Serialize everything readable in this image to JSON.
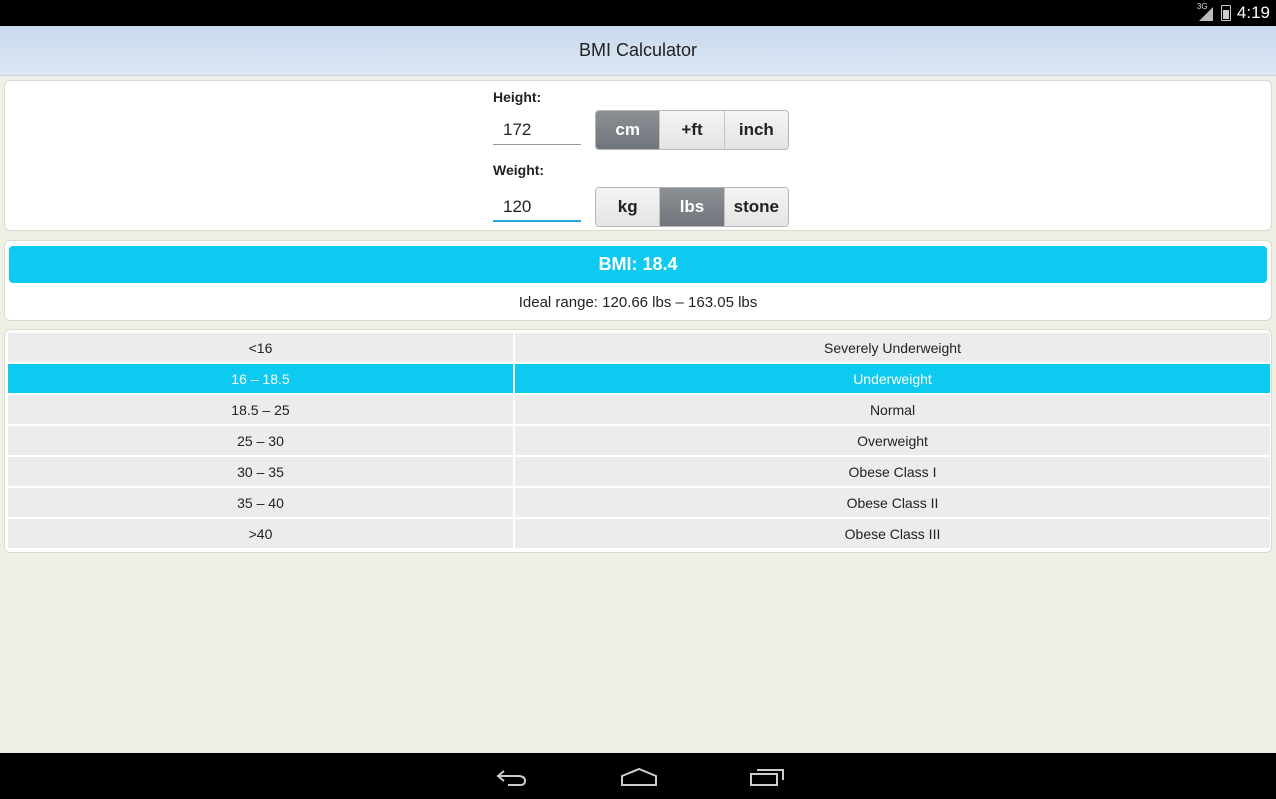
{
  "status_bar": {
    "network_label": "3G",
    "time": "4:19"
  },
  "header": {
    "title": "BMI Calculator"
  },
  "height": {
    "label": "Height:",
    "value": "172",
    "units": [
      {
        "label": "cm",
        "active": true
      },
      {
        "label": "+ft",
        "active": false
      },
      {
        "label": "inch",
        "active": false
      }
    ]
  },
  "weight": {
    "label": "Weight:",
    "value": "120",
    "units": [
      {
        "label": "kg",
        "active": false
      },
      {
        "label": "lbs",
        "active": true
      },
      {
        "label": "stone",
        "active": false
      }
    ]
  },
  "result": {
    "bmi_text": "BMI: 18.4",
    "ideal_range_text": "Ideal range: 120.66 lbs – 163.05 lbs",
    "highlight_color": "#0ccaf0"
  },
  "bmi_table": {
    "rows": [
      {
        "range": "<16",
        "category": "Severely Underweight",
        "highlighted": false
      },
      {
        "range": "16 – 18.5",
        "category": "Underweight",
        "highlighted": true
      },
      {
        "range": "18.5 – 25",
        "category": "Normal",
        "highlighted": false
      },
      {
        "range": "25 – 30",
        "category": "Overweight",
        "highlighted": false
      },
      {
        "range": "30 – 35",
        "category": "Obese Class I",
        "highlighted": false
      },
      {
        "range": "35 – 40",
        "category": "Obese Class II",
        "highlighted": false
      },
      {
        "range": ">40",
        "category": "Obese Class III",
        "highlighted": false
      }
    ]
  },
  "nav_bar": {
    "buttons": [
      "back-icon",
      "home-icon",
      "recent-apps-icon"
    ]
  }
}
